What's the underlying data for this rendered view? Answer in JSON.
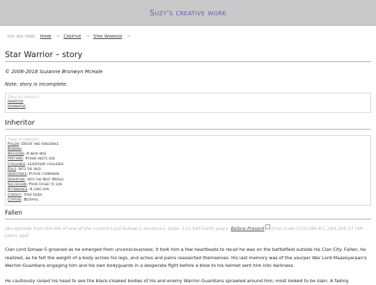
{
  "site": {
    "title": "Suzy's creative work"
  },
  "breadcrumb": {
    "prefix": "You are here:",
    "separator": "→",
    "items": [
      "Home",
      "Creative",
      "Star Warrior"
    ]
  },
  "page": {
    "title": "Star Warrior – story",
    "copyright": "© 2006-2018 Suzanne Bronwyn McHale",
    "note": "Note: story is incomplete."
  },
  "toc1": {
    "label": "Table of contents:",
    "items": [
      "Inheritor",
      "Dominator"
    ]
  },
  "section_inheritor": {
    "title": "Inheritor"
  },
  "toc2": {
    "label": "Table of contents:",
    "items": [
      {
        "link": "Fallen",
        "desc": ": Defeat and vengeance"
      },
      {
        "link": "Bonding",
        "desc": ""
      },
      {
        "link": "Assassins",
        "desc": ": A near-miss"
      },
      {
        "link": "Hatching",
        "desc": ": Father meets son"
      },
      {
        "link": "Challenge",
        "desc": ": Leadership challenge"
      },
      {
        "link": "Exile",
        "desc": ": Into the wild"
      },
      {
        "link": "Inheritance",
        "desc": ": Future companion"
      },
      {
        "link": "Departure",
        "desc": ": Into the Next World"
      },
      {
        "link": "Succession",
        "desc": ": From father to son"
      },
      {
        "link": "Attendance",
        "desc": ": A long run"
      },
      {
        "link": "Contact",
        "desc": ": Star Gods"
      },
      {
        "link": "Capture",
        "desc": ": Betrayal"
      }
    ]
  },
  "section_fallen": {
    "title": "Fallen"
  },
  "epigraph": {
    "before": "[An episode from the life of one of the current Lord Sohaar's ancestors. Date: 112,540 Earth years, ",
    "link": "Before Present",
    "after": " time scale (110,590 B.C.)/64,308.57 HW years ago]"
  },
  "paragraphs": [
    {
      "start": "Clan Lord Sohaar-5 groaned as he emerged from unconsciousness; it took him a few heartbeats to recall he was on the battlefield outside his Clan City. ",
      "italic": "Fallen",
      "end": ", he realized, as he felt the weight of a body across his legs, and aches and pains reasserted themselves. His last memory was of the usurper War Lord Maazeyaraan's Warrior-Guardians engaging him and his own bodyguards in a desperate fight before a blow to his helmet sent him into darkness."
    },
    {
      "start": "He cautiously raised his head to see the black-cloaked bodies of his and enemy Warrior-Guardians sprawled around him; most looked to be slain. A fading",
      "italic": "",
      "end": ""
    }
  ]
}
